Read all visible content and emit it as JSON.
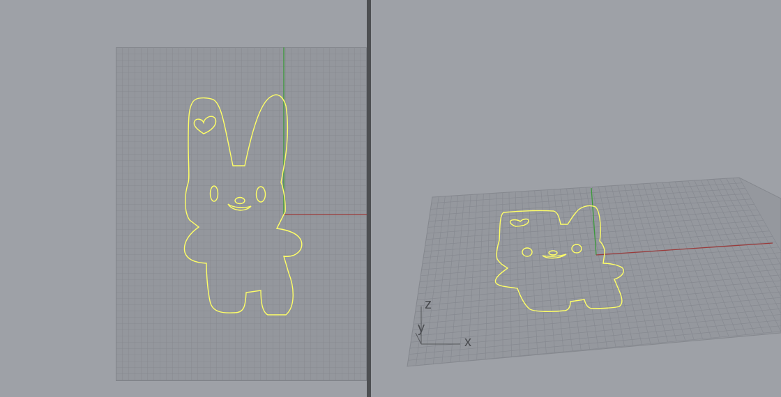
{
  "app": {
    "view_count": 2
  },
  "viewports": {
    "left": {
      "projection": "top",
      "background": "#9ea1a7",
      "grid_color": "#808389",
      "grid_fill": "#93969c"
    },
    "right": {
      "projection": "perspective",
      "background": "#9ea1a7"
    }
  },
  "colors": {
    "curve": "#ffff66",
    "x_axis": "#9a3b3b",
    "y_axis": "#3a9a3a",
    "splitter": "#4d4f52"
  },
  "axis_gizmo": {
    "z_label": "z",
    "y_label": "y",
    "x_label": "x"
  }
}
